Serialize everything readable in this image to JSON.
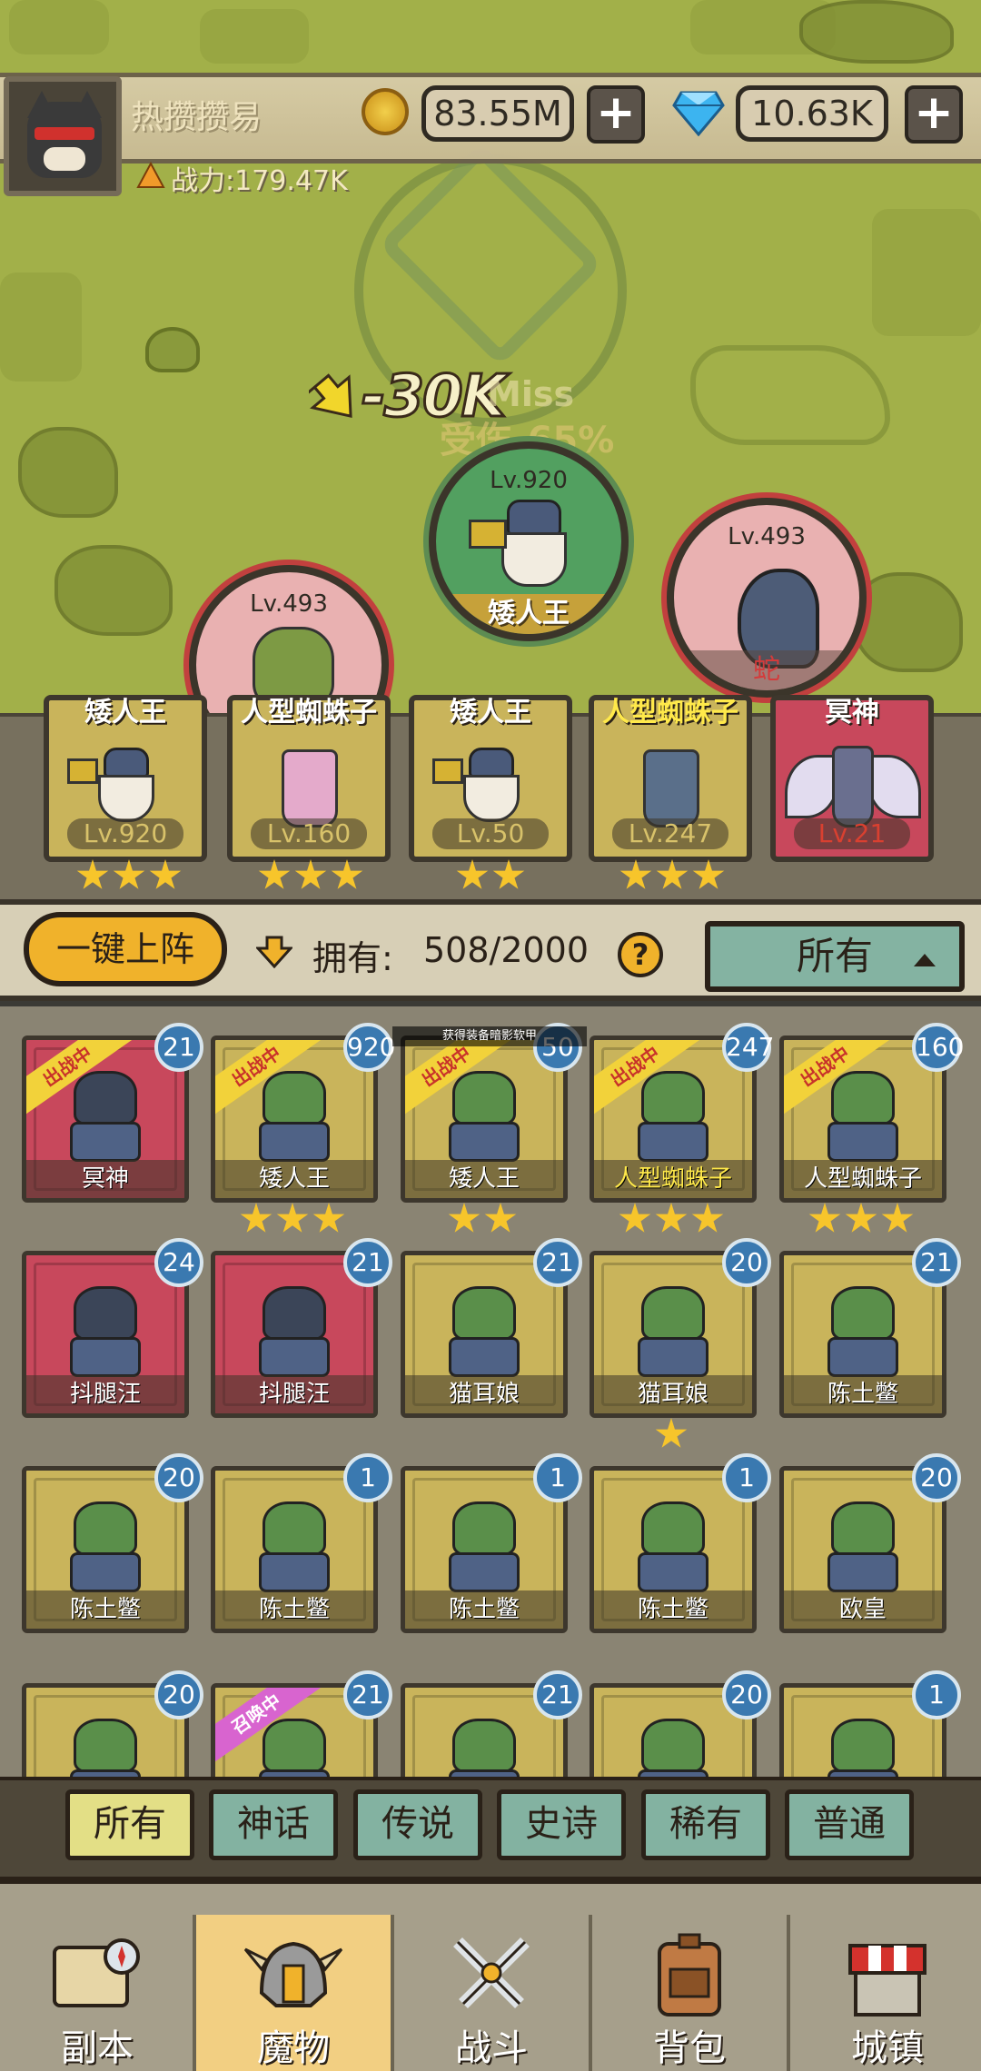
{
  "player": {
    "name": "热攒攒易",
    "power": "战力:179.47K"
  },
  "currency": {
    "gold": "83.55M",
    "gems": "10.63K",
    "plus": "+"
  },
  "battle": {
    "damage": "-30K",
    "miss": "Miss",
    "defense": "受伤-65%",
    "units": [
      {
        "level": "Lv.920",
        "name": "矮人王"
      },
      {
        "level": "Lv.493",
        "name": ""
      },
      {
        "level": "Lv.493",
        "name": "蛇"
      }
    ]
  },
  "team_slots": [
    {
      "name": "矮人王",
      "level": "Lv.920",
      "stars": 3
    },
    {
      "name": "人型蜘蛛子",
      "level": "Lv.160",
      "stars": 3
    },
    {
      "name": "矮人王",
      "level": "Lv.50",
      "stars": 2
    },
    {
      "name": "人型蜘蛛子",
      "level": "Lv.247",
      "stars": 3
    },
    {
      "name": "冥神",
      "level": "Lv.21",
      "stars": 0
    }
  ],
  "controls": {
    "deploy": "一键上阵",
    "own_label": "拥有:",
    "own_count": "508/2000",
    "help": "?",
    "filter": "所有"
  },
  "tooltip": "获得装备暗影软甲",
  "roster": [
    {
      "name": "冥神",
      "badge": "21",
      "tag": "出战中",
      "stars": 0,
      "bg": "red"
    },
    {
      "name": "矮人王",
      "badge": "920",
      "tag": "出战中",
      "stars": 3,
      "bg": "gold"
    },
    {
      "name": "矮人王",
      "badge": "50",
      "tag": "出战中",
      "stars": 2,
      "bg": "gold"
    },
    {
      "name": "人型蜘蛛子",
      "badge": "247",
      "tag": "出战中",
      "stars": 3,
      "bg": "gold"
    },
    {
      "name": "人型蜘蛛子",
      "badge": "160",
      "tag": "出战中",
      "stars": 3,
      "bg": "gold"
    },
    {
      "name": "抖腿汪",
      "badge": "24",
      "tag": "",
      "stars": 0,
      "bg": "red"
    },
    {
      "name": "抖腿汪",
      "badge": "21",
      "tag": "",
      "stars": 0,
      "bg": "red"
    },
    {
      "name": "猫耳娘",
      "badge": "21",
      "tag": "",
      "stars": 0,
      "bg": "gold"
    },
    {
      "name": "猫耳娘",
      "badge": "20",
      "tag": "",
      "stars": 1,
      "bg": "gold"
    },
    {
      "name": "陈土鳖",
      "badge": "21",
      "tag": "",
      "stars": 0,
      "bg": "gold"
    },
    {
      "name": "陈土鳖",
      "badge": "20",
      "tag": "",
      "stars": 0,
      "bg": "gold"
    },
    {
      "name": "陈土鳖",
      "badge": "1",
      "tag": "",
      "stars": 0,
      "bg": "gold"
    },
    {
      "name": "陈土鳖",
      "badge": "1",
      "tag": "",
      "stars": 0,
      "bg": "gold"
    },
    {
      "name": "陈土鳖",
      "badge": "1",
      "tag": "",
      "stars": 0,
      "bg": "gold"
    },
    {
      "name": "欧皇",
      "badge": "20",
      "tag": "",
      "stars": 0,
      "bg": "gold"
    },
    {
      "name": "",
      "badge": "20",
      "tag": "",
      "stars": 0,
      "bg": "gold"
    },
    {
      "name": "",
      "badge": "21",
      "tag": "召唤中",
      "stars": 0,
      "bg": "gold"
    },
    {
      "name": "",
      "badge": "21",
      "tag": "",
      "stars": 0,
      "bg": "gold"
    },
    {
      "name": "",
      "badge": "20",
      "tag": "",
      "stars": 0,
      "bg": "gold"
    },
    {
      "name": "",
      "badge": "1",
      "tag": "",
      "stars": 0,
      "bg": "gold"
    }
  ],
  "rarity_tabs": [
    "所有",
    "神话",
    "传说",
    "史诗",
    "稀有",
    "普通"
  ],
  "nav": [
    {
      "label": "副本",
      "icon": "map-icon"
    },
    {
      "label": "魔物",
      "icon": "monster-helmet-icon"
    },
    {
      "label": "战斗",
      "icon": "crossed-swords-icon"
    },
    {
      "label": "背包",
      "icon": "backpack-icon"
    },
    {
      "label": "城镇",
      "icon": "shop-icon"
    }
  ]
}
